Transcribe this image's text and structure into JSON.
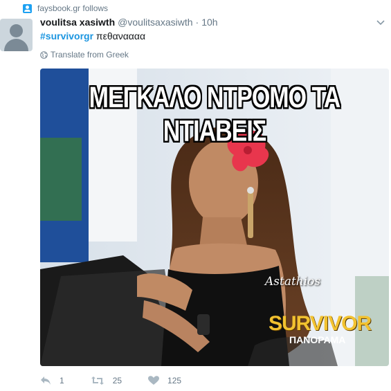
{
  "context": {
    "text": "faysbook.gr follows",
    "icon": "follow-context-icon"
  },
  "tweet": {
    "name": "voulitsa xasiwth",
    "handle": "@voulitsaxasiwth",
    "dot": "·",
    "time": "10h",
    "hashtag": "#survivorgr",
    "text": " πεθαναααα",
    "translate_label": "Translate from Greek"
  },
  "media": {
    "caption": "ΜΕΓΚΑΛΟ ΝΤΡΟΜΟ ΤΑ ΝΤΙΑΒΕΙΣ",
    "watermark": "Astathios",
    "logo_main": "SURVIVOR",
    "logo_sub": "ΠΑΝΟΡΑΜΑ"
  },
  "actions": {
    "replies": "1",
    "retweets": "25",
    "likes": "125"
  },
  "colors": {
    "accent": "#1da1f2",
    "hashtag": "#1b95e0",
    "muted": "#657786",
    "text": "#14171a"
  }
}
